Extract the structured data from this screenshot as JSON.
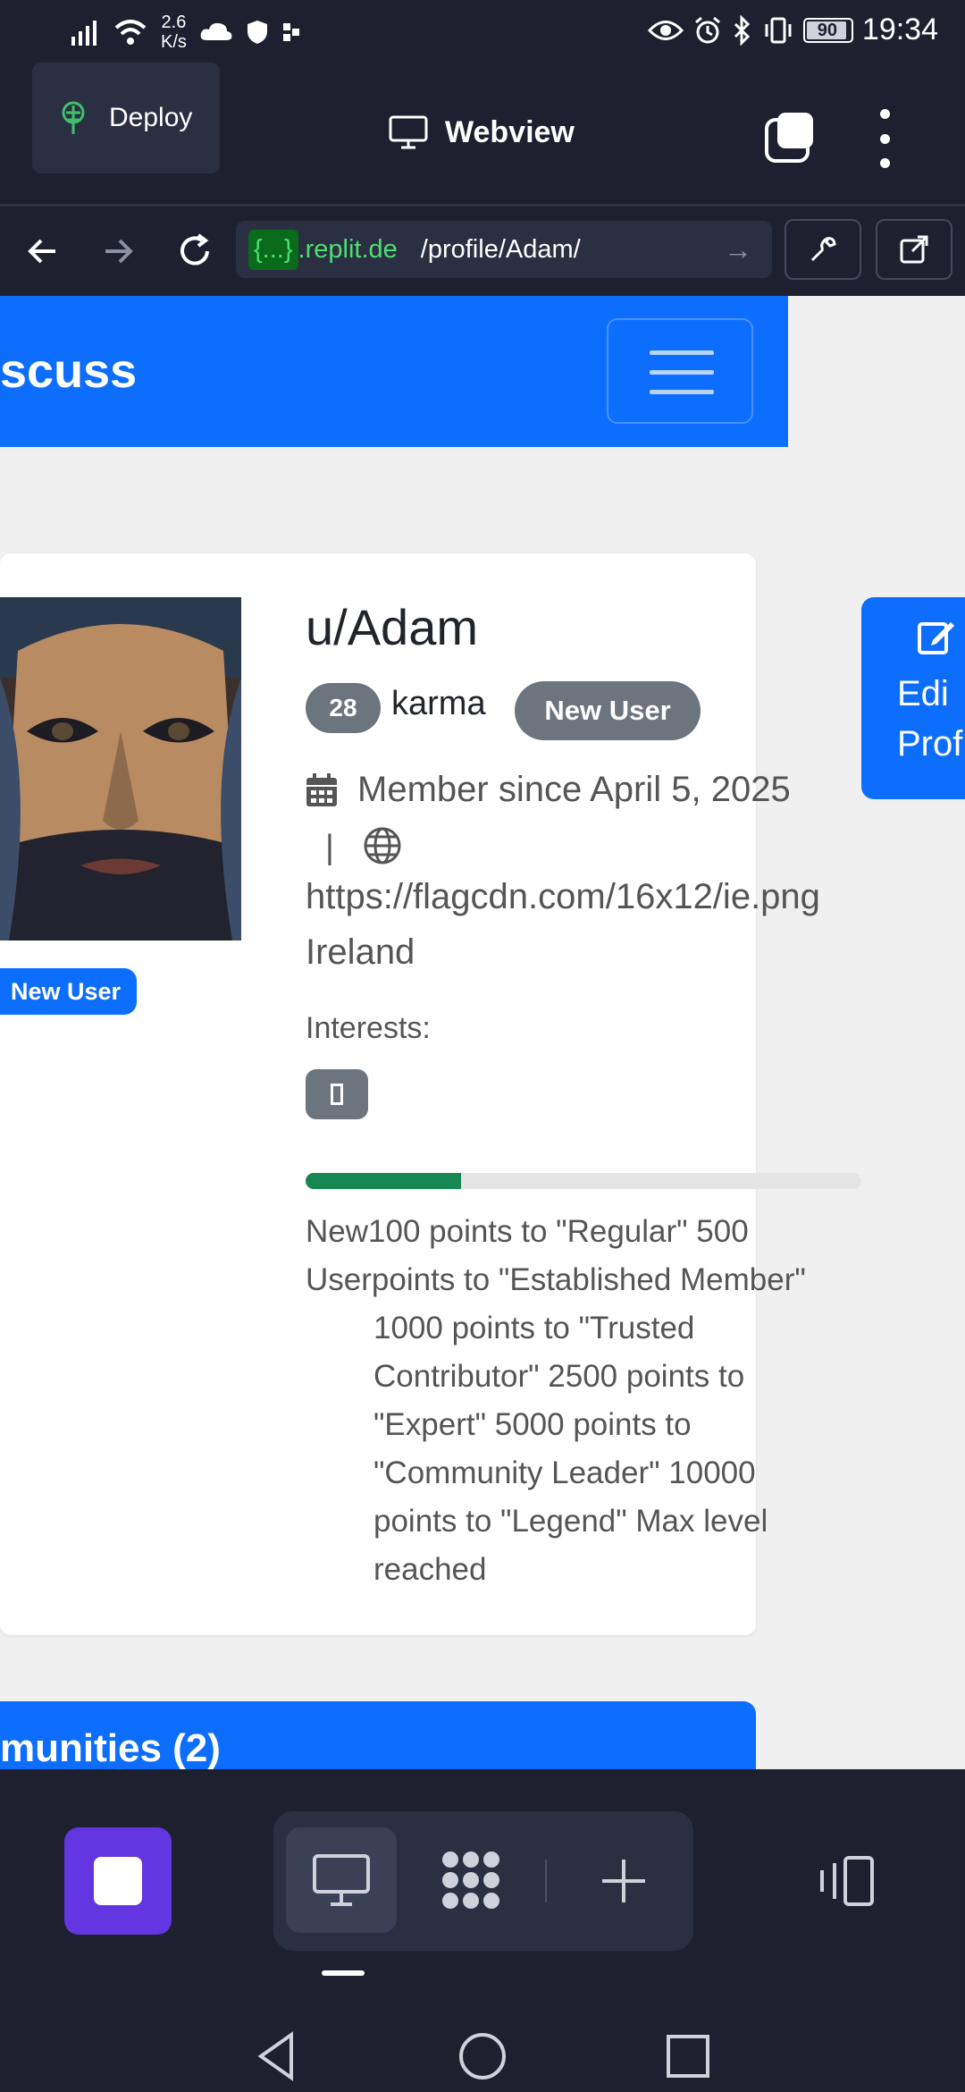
{
  "status_bar": {
    "net_speed_value": "2.6",
    "net_speed_unit": "K/s",
    "battery": "90",
    "time": "19:34"
  },
  "app_header": {
    "deploy_label": "Deploy",
    "webview_label": "Webview"
  },
  "url_bar": {
    "tag": "{...}",
    "host": ".replit.de",
    "path": "/profile/Adam/",
    "go_icon": "arrow-right-icon"
  },
  "site": {
    "brand": "scuss",
    "brand_color": "#0d6efd"
  },
  "profile": {
    "username": "u/Adam",
    "karma_value": "28",
    "karma_label": "karma",
    "badge": "New User",
    "avatar_badge": "New User",
    "member_since": "Member since April 5, 2025",
    "separator": "|",
    "flag_url": "https://flagcdn.com/16x12/ie.png",
    "country": "Ireland",
    "interests_label": "Interests:",
    "progress_fraction": 0.28,
    "level_lines_1": [
      "New100 points to \"Regular\" 500",
      "Userpoints to \"Established Member\""
    ],
    "level_lines_2": [
      "1000 points to \"Trusted",
      "Contributor\" 2500 points to",
      "\"Expert\" 5000 points to",
      "\"Community Leader\" 10000",
      "points to \"Legend\" Max level",
      "reached"
    ],
    "edit_lines": [
      "Edi",
      "Prof"
    ]
  },
  "communities": {
    "header": "munities (2)"
  }
}
